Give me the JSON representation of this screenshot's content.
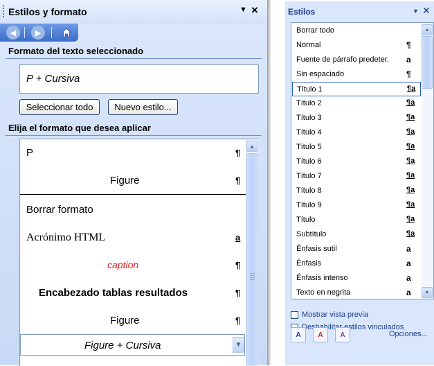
{
  "left_pane": {
    "title": "Estilos y formato",
    "nav": {
      "back": "◀",
      "forward": "▶",
      "home": "home-icon"
    },
    "section_selected": "Formato del texto seleccionado",
    "current_format": "P + Cursiva",
    "select_all_button": "Seleccionar todo",
    "new_style_button": "Nuevo estilo...",
    "section_apply": "Elija el formato que desea aplicar",
    "items": [
      {
        "label": "P",
        "mark": "¶"
      },
      {
        "label": "Figure",
        "mark": "¶"
      },
      {
        "label": "Borrar formato",
        "mark": ""
      },
      {
        "label": "Acrónimo HTML",
        "mark": "a"
      },
      {
        "label": "caption",
        "mark": "¶"
      },
      {
        "label": "Encabezado tablas resultados",
        "mark": "¶"
      },
      {
        "label": "Figure",
        "mark": "¶"
      }
    ],
    "selected_dropdown": "Figure + Cursiva"
  },
  "right_pane": {
    "title": "Estilos",
    "items": [
      {
        "label": "Borrar todo",
        "mark": ""
      },
      {
        "label": "Normal",
        "mark": "¶"
      },
      {
        "label": "Fuente de párrafo predeter.",
        "mark": "a"
      },
      {
        "label": "Sin espaciado",
        "mark": "¶"
      },
      {
        "label": "Título 1",
        "mark": "¶a"
      },
      {
        "label": "Título 2",
        "mark": "¶a"
      },
      {
        "label": "Título 3",
        "mark": "¶a"
      },
      {
        "label": "Título 4",
        "mark": "¶a"
      },
      {
        "label": "Título 5",
        "mark": "¶a"
      },
      {
        "label": "Título 6",
        "mark": "¶a"
      },
      {
        "label": "Título 7",
        "mark": "¶a"
      },
      {
        "label": "Título 8",
        "mark": "¶a"
      },
      {
        "label": "Título 9",
        "mark": "¶a"
      },
      {
        "label": "Título",
        "mark": "¶a"
      },
      {
        "label": "Subtítulo",
        "mark": "¶a"
      },
      {
        "label": "Énfasis sutil",
        "mark": "a"
      },
      {
        "label": "Énfasis",
        "mark": "a"
      },
      {
        "label": "Énfasis intenso",
        "mark": "a"
      },
      {
        "label": "Texto en negrita",
        "mark": "a"
      }
    ],
    "show_preview": "Mostrar vista previa",
    "disable_linked": "Deshabilitar estilos vinculados",
    "options_link": "Opciones..."
  },
  "colors": {
    "accent": "#3b6cc8",
    "caption_red": "#e11b1b",
    "link_blue": "#1a3e8c"
  }
}
